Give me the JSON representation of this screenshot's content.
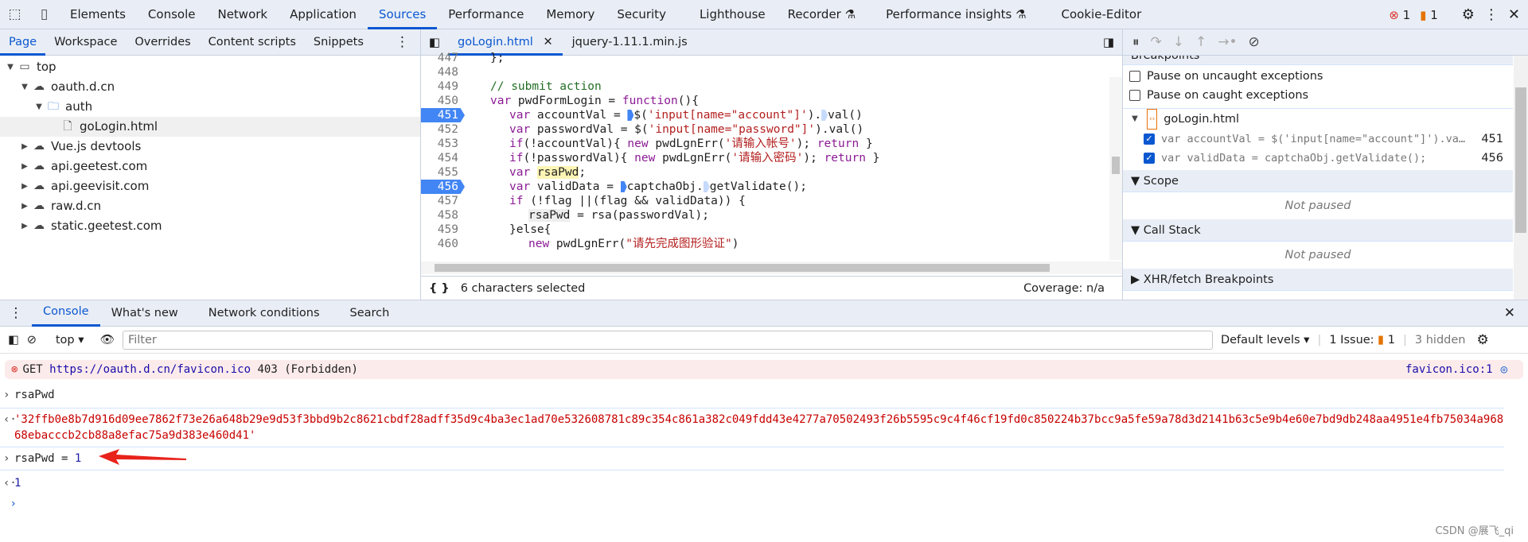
{
  "topbar": {
    "tabs": [
      "Elements",
      "Console",
      "Network",
      "Application",
      "Sources",
      "Performance",
      "Memory",
      "Security",
      "Lighthouse",
      "Recorder",
      "Performance insights",
      "Cookie-Editor"
    ],
    "active": "Sources",
    "errors": "1",
    "warnings": "1"
  },
  "navigator": {
    "tabs": [
      "Page",
      "Workspace",
      "Overrides",
      "Content scripts",
      "Snippets"
    ],
    "tree": [
      {
        "label": "top",
        "icon": "frame-icon",
        "depth": 0,
        "open": true
      },
      {
        "label": "oauth.d.cn",
        "icon": "cloud-icon",
        "depth": 1,
        "open": true
      },
      {
        "label": "auth",
        "icon": "folder-icon",
        "depth": 2,
        "open": true
      },
      {
        "label": "goLogin.html",
        "icon": "file-icon",
        "depth": 3,
        "selected": true
      },
      {
        "label": "Vue.js devtools",
        "icon": "cloud-icon",
        "depth": 1
      },
      {
        "label": "api.geetest.com",
        "icon": "cloud-icon",
        "depth": 1
      },
      {
        "label": "api.geevisit.com",
        "icon": "cloud-icon",
        "depth": 1
      },
      {
        "label": "raw.d.cn",
        "icon": "cloud-icon",
        "depth": 1
      },
      {
        "label": "static.geetest.com",
        "icon": "cloud-icon",
        "depth": 1
      }
    ]
  },
  "editor": {
    "tabs": [
      "goLogin.html",
      "jquery-1.11.1.min.js"
    ],
    "status": "6 characters selected",
    "coverage": "Coverage: n/a",
    "lines": [
      "447",
      "448",
      "449",
      "450",
      "451",
      "452",
      "453",
      "454",
      "455",
      "456",
      "457",
      "458",
      "459",
      "460"
    ],
    "code": {
      "l447": "};",
      "l449": "// submit action",
      "l450a": "var",
      " l450b": "",
      "l450": " pwdFormLogin = ",
      "l450f": "function",
      "l450e": "(){",
      "l451a": "var accountVal = ",
      "l451b": "$(",
      "l451c": "'input[name=\"account\"]'",
      ")": "",
      "l451d": ").",
      "l451e": "val()",
      "l452a": "var passwordVal = $(",
      "l452c": "'input[name=\"password\"]'",
      "l452d": ").val()",
      "l453a": "if(!accountVal){ ",
      "l453n": "new",
      " l453": "",
      "l453b": " pwdLgnErr(",
      "l453c": "'请输入帐号'",
      "l453d": "); ",
      "l453r": "return",
      "l453e": " }",
      "l454a": "if(!passwordVal){ ",
      "l454c": "'请输入密码'",
      "l455a": "var ",
      "l455b": "rsaPwd",
      "l455c": ";",
      "l456a": "var validData = ",
      "l456b": "captchaObj.",
      "l456c": "getValidate();",
      "l457a": "if (!flag ||(flag && validData)) {",
      "l458a": "rsaPwd",
      "l458b": " = rsa(passwordVal);",
      "l459a": "}else{",
      "l460c": "\"请先完成图形验证\"",
      "l460d": ")"
    }
  },
  "debugger": {
    "breakpoints_header": "Breakpoints",
    "pause_uncaught": "Pause on uncaught exceptions",
    "pause_caught": "Pause on caught exceptions",
    "bp_file": "goLogin.html",
    "bps": [
      {
        "code": "var accountVal = $('input[name=\"account\"]').va…",
        "line": "451",
        "checked": true
      },
      {
        "code": "var validData = captchaObj.getValidate();",
        "line": "456",
        "checked": true
      }
    ],
    "scope": "Scope",
    "callstack": "Call Stack",
    "not_paused": "Not paused",
    "xhr": "XHR/fetch Breakpoints"
  },
  "drawer": {
    "tabs": [
      "Console",
      "What's new",
      "Network conditions",
      "Search"
    ],
    "context": "top",
    "filter_placeholder": "Filter",
    "levels": "Default levels",
    "issues": "1 Issue:",
    "issues_count": "1",
    "hidden": "3 hidden"
  },
  "console": {
    "error": {
      "method": "GET",
      "url": "https://oauth.d.cn/favicon.ico",
      "status": "403 (Forbidden)",
      "source": "favicon.ico:1"
    },
    "input1": "rsaPwd",
    "output1": "'32ffb0e8b7d916d09ee7862f73e26a648b29e9d53f3bbd9b2c8621cbdf28adff35d9c4ba3ec1ad70e532608781c89c354c861a382c049fdd43e4277a70502493f26b5595c9c4f46cf19fd0c850224b37bcc9a5fe59a78d3d2141b63c5e9b4e60e7bd9db248aa4951e4fb75034a96868ebacccb2cb88a8efac75a9d383e460d41'",
    "input2a": "rsaPwd = ",
    "input2b": "1",
    "output2": "1"
  },
  "watermark": "CSDN @展飞_qi",
  "colors": {
    "accent": "#0b57d0",
    "breakpoint": "#4285f4",
    "error": "#dc362e",
    "arrow": "#e8231b"
  }
}
